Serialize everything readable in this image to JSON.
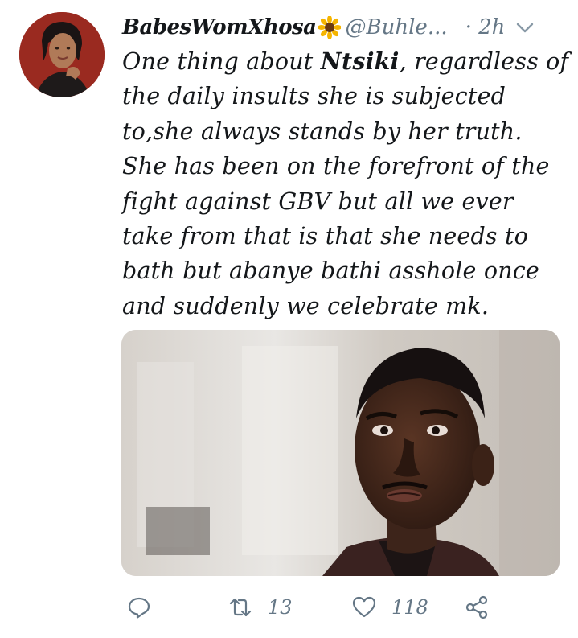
{
  "author": {
    "display_name": "BabesWomXhosa",
    "emoji_name": "sunflower-icon",
    "handle": "@Buhle...",
    "time": "· 2h"
  },
  "tweet": {
    "lines": [
      [
        "One thing about ",
        "Ntsiki",
        ", regardless of"
      ],
      "the daily insults she is subjected",
      "to,she always stands by her truth.",
      "She has been on the forefront of the",
      "fight against GBV but all we ever",
      "take from that is that she needs to",
      "bath but abanye bathi asshole once",
      "and suddenly we celebrate mk."
    ]
  },
  "actions": {
    "reply_count": "",
    "retweet_count": "13",
    "like_count": "118"
  },
  "colors": {
    "text": "#14171a",
    "secondary": "#657786"
  }
}
